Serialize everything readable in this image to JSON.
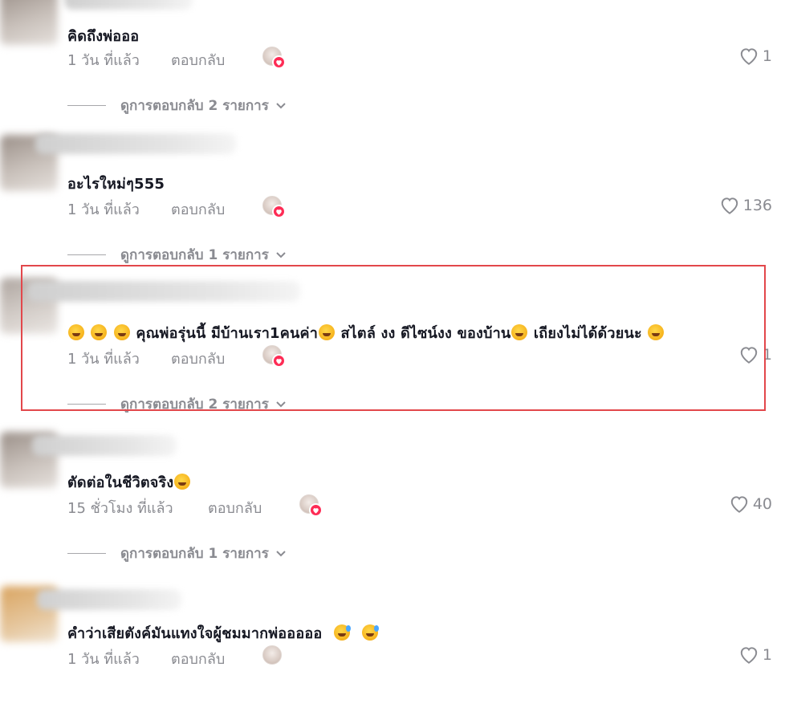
{
  "comments": [
    {
      "text": "คิดถึงพ่อออ",
      "time": "1 วัน ที่แล้ว",
      "reply_label": "ตอบกลับ",
      "likes": "1",
      "view_replies": "ดูการตอบกลับ 2 รายการ",
      "emoji_icons": []
    },
    {
      "text": "อะไรใหม่ๆ555",
      "time": "1 วัน ที่แล้ว",
      "reply_label": "ตอบกลับ",
      "likes": "136",
      "view_replies": "ดูการตอบกลับ 1 รายการ",
      "emoji_icons": []
    },
    {
      "text": "คุณพ่อรุ่นนี้ มีบ้านเรา1คนค่า",
      "text_part2": "สไตล์ งง ดีไซน์งง ของบ้าน",
      "text_part3": "เถียงไม่ได้ด้วยนะ",
      "time": "1 วัน ที่แล้ว",
      "reply_label": "ตอบกลับ",
      "likes": "1",
      "view_replies": "ดูการตอบกลับ 2 รายการ",
      "emoji_icons": [
        "rofl-emoji-icon",
        "rofl-emoji-icon",
        "rofl-emoji-icon",
        "rofl-emoji-icon",
        "pleading-emoji-icon",
        "laughing-emoji-icon"
      ],
      "highlighted": true,
      "highlight_color": "#e2474b"
    },
    {
      "text": "ตัดต่อในชีวิตจริง",
      "time": "15 ชั่วโมง ที่แล้ว",
      "reply_label": "ตอบกลับ",
      "likes": "40",
      "view_replies": "ดูการตอบกลับ 1 รายการ",
      "emoji_icons": [
        "rofl-emoji-icon"
      ]
    },
    {
      "text": "คำว่าเสียตังค์มันแทงใจผู้ชมมากพ่อออออ",
      "time": "1 วัน ที่แล้ว",
      "reply_label": "ตอบกลับ",
      "likes": "1",
      "emoji_icons": [
        "sweat-smile-emoji-icon",
        "sweat-smile-emoji-icon"
      ]
    }
  ],
  "colors": {
    "text": "#161823",
    "muted": "#8a8b91",
    "creator_badge": "#fe2c55"
  }
}
